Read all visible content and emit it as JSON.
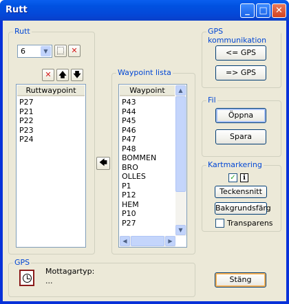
{
  "window": {
    "title": "Rutt"
  },
  "rutt": {
    "label": "Rutt",
    "route_value": "6",
    "list_header": "Ruttwaypoint",
    "items": [
      "P27",
      "P21",
      "P22",
      "P23",
      "P24"
    ]
  },
  "waypoints": {
    "label": "Waypoint lista",
    "header": "Waypoint",
    "items": [
      "P43",
      "P44",
      "P45",
      "P46",
      "P47",
      "P48",
      "BOMMEN",
      "BRO",
      "OLLES",
      "P1",
      "P12",
      "HEM",
      "P10",
      "P27"
    ]
  },
  "gps_comm": {
    "label": "GPS kommunikation",
    "from_gps": "<= GPS",
    "to_gps": "=> GPS"
  },
  "fil": {
    "label": "Fil",
    "open": "Öppna",
    "save": "Spara"
  },
  "kart": {
    "label": "Kartmarkering",
    "font": "Teckensnitt",
    "bg": "Bakgrundsfärg",
    "transp": "Transparens"
  },
  "gps": {
    "label": "GPS",
    "receiver_label": "Mottagartyp:",
    "receiver_value": "..."
  },
  "close_button": "Stäng"
}
